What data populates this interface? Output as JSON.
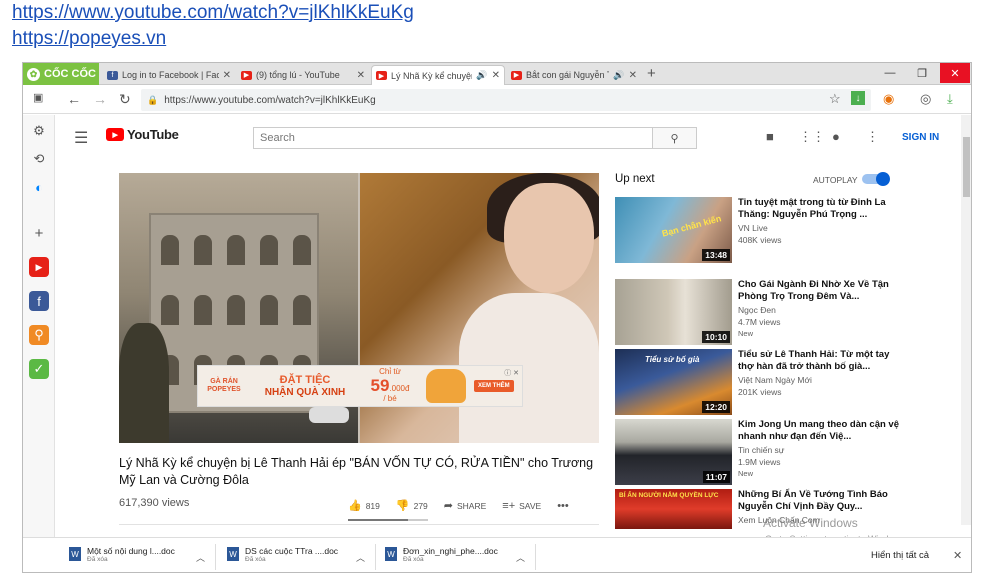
{
  "links": [
    "https://www.youtube.com/watch?v=jlKhlKkEuKg",
    "https://popeyes.vn"
  ],
  "browser": {
    "brand": "CỐC CỐC",
    "tabs": [
      {
        "label": "Log in to Facebook | Facebook"
      },
      {
        "label": "(9) tổng lú - YouTube"
      },
      {
        "label": "Lý Nhã Kỳ kể chuyện bị Lê Thanh Hải ép"
      },
      {
        "label": "Bắt con gái Nguyễn Thanh"
      }
    ],
    "url": "https://www.youtube.com/watch?v=jlKhlKkEuKg"
  },
  "youtube": {
    "logo": "YouTube",
    "search_placeholder": "Search",
    "signin": "SIGN IN"
  },
  "ad": {
    "brand_line1": "GÀ RÁN",
    "brand_line2": "POPEYES",
    "headline1": "ĐẶT TIỆC",
    "headline2": "NHẬN QUÀ XINH",
    "price_prefix": "Chỉ từ",
    "price_big": "59",
    "price_suffix": ".000đ",
    "price_unit": "/ bé",
    "cta": "XEM THÊM"
  },
  "video": {
    "title": "Lý Nhã Kỳ kể chuyện bị Lê Thanh Hải ép \"BÁN VỐN TỰ CÓ, RỬA TIỀN\" cho Trương Mỹ Lan và Cường Đôla",
    "views": "617,390 views",
    "likes": "819",
    "dislikes": "279",
    "share": "SHARE",
    "save": "SAVE",
    "like_ratio": 0.746
  },
  "upnext": {
    "label": "Up next",
    "autoplay": "AUTOPLAY",
    "items": [
      {
        "title": "Tin tuyệt mật trong tù từ Đinh La Thăng: Nguyễn Phú Trọng ...",
        "channel": "VN Live",
        "views": "408K views",
        "badge": "",
        "duration": "13:48",
        "thumb_text": "Bạn chân kiến"
      },
      {
        "title": "Cho Gái Ngành Đi Nhờ Xe Về Tận Phòng Trọ Trong Đêm Và...",
        "channel": "Ngọc Đen",
        "views": "4.7M views",
        "badge": "New",
        "duration": "10:10",
        "thumb_text": ""
      },
      {
        "title": "Tiểu sử Lê Thanh Hải: Từ một tay thợ hàn đã trở thành bố già...",
        "channel": "Việt Nam Ngày Mới",
        "views": "201K views",
        "badge": "",
        "duration": "12:20",
        "thumb_text": "Tiểu sử bố già"
      },
      {
        "title": "Kim Jong Un mang theo dàn cận vệ nhanh như đạn đến Việ...",
        "channel": "Tin chiến sự",
        "views": "1.9M views",
        "badge": "New",
        "duration": "11:07",
        "thumb_text": ""
      },
      {
        "title": "Những Bí Ẩn Về Tướng Tình Báo Nguyễn Chí Vịnh Đầy Quy...",
        "channel": "Xem Luôn Chấn Com",
        "views": "",
        "badge": "",
        "duration": "",
        "thumb_text": "BÍ ẨN NGƯỜI NẮM QUYỀN LỰC"
      }
    ]
  },
  "downloads": [
    {
      "name": "Một số nội dung l....doc",
      "status": "Đã xóa"
    },
    {
      "name": "DS các cuộc TTra ....doc",
      "status": "Đã xóa"
    },
    {
      "name": "Đơn_xin_nghi_phe....doc",
      "status": "Đã xóa"
    }
  ],
  "downloads_show_all": "Hiển thị tất cả",
  "watermark": {
    "title": "Activate Windows",
    "subtitle": "Go to Settings to activate Windows."
  }
}
